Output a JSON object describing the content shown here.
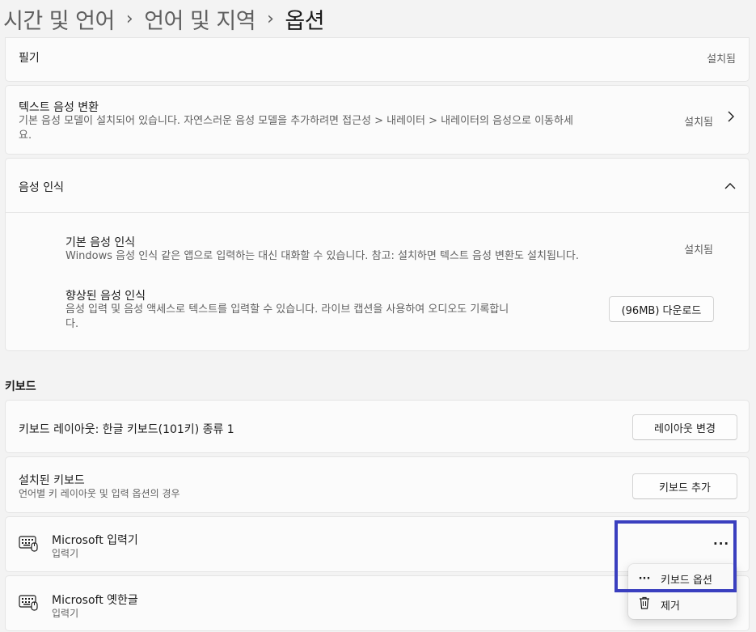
{
  "breadcrumb": {
    "items": [
      "시간 및 언어",
      "언어 및 지역"
    ],
    "current": "옵션",
    "separator": "›"
  },
  "handwriting": {
    "title": "필기",
    "status": "설치됨"
  },
  "tts": {
    "title": "텍스트 음성 변환",
    "desc_line1": "기본 음성 모델이 설치되어 있습니다. 자연스러운 음성 모델을 추가하려면 접근성 > 내레이터 > 내레이터의 음성으로 이동하세",
    "desc_line2": "요.",
    "status": "설치됨"
  },
  "speech": {
    "title": "음성 인식",
    "basic": {
      "title": "기본 음성 인식",
      "desc": "Windows 음성 인식 같은 앱으로 입력하는 대신 대화할 수 있습니다. 참고: 설치하면 텍스트 음성 변환도 설치됩니다.",
      "status": "설치됨"
    },
    "enhanced": {
      "title": "향상된 음성 인식",
      "desc_line1": "음성 입력 및 음성 액세스로 텍스트를 입력할 수 있습니다. 라이브 캡션을 사용하여 오디오도 기록합니",
      "desc_line2": "다.",
      "button": "(96MB) 다운로드"
    }
  },
  "keyboard": {
    "section_label": "키보드",
    "layout": {
      "title": "키보드 레이아웃: 한글 키보드(101키) 종류 1",
      "button": "레이아웃 변경"
    },
    "installed": {
      "title": "설치된 키보드",
      "desc": "언어별 키 레이아웃 및 입력 옵션의 경우",
      "button": "키보드 추가"
    },
    "items": [
      {
        "title": "Microsoft 입력기",
        "subtitle": "입력기"
      },
      {
        "title": "Microsoft 옛한글",
        "subtitle": "입력기"
      }
    ],
    "more_label": "···"
  },
  "context_menu": {
    "items": [
      {
        "icon": "more-icon",
        "glyph": "···",
        "label": "키보드 옵션"
      },
      {
        "icon": "trash-icon",
        "glyph": "",
        "label": "제거"
      }
    ]
  },
  "colors": {
    "highlight": "#3a3fbf",
    "card": "#fbfbfb",
    "background": "#f3f3f3"
  }
}
